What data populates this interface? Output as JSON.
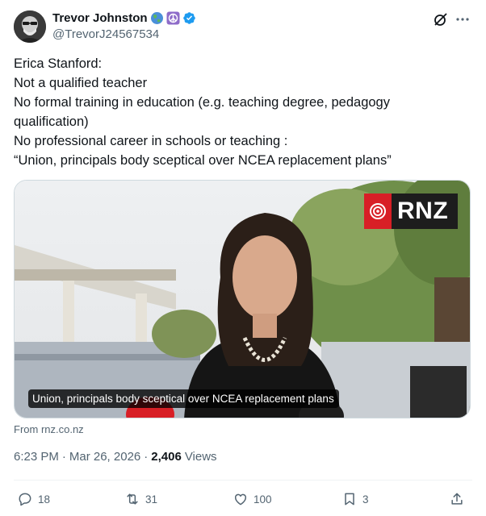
{
  "author": {
    "name": "Trevor Johnston",
    "handle": "@TrevorJ24567534",
    "badges": [
      "globe-emoji",
      "peace-symbol-emoji",
      "verified-badge"
    ]
  },
  "tweet": {
    "lines": [
      "Erica Stanford:",
      "Not a qualified teacher",
      "No formal training in education (e.g. teaching degree, pedagogy",
      "qualification)",
      "No professional career in schools or teaching :",
      "“Union, principals body sceptical over NCEA replacement plans”"
    ]
  },
  "card": {
    "caption": "Union, principals body sceptical over NCEA replacement plans",
    "logo_text": "RNZ",
    "source": "From rnz.co.nz"
  },
  "meta": {
    "time": "6:23 PM",
    "separator": "·",
    "date": "Mar 26, 2026",
    "views_count": "2,406",
    "views_label": "Views"
  },
  "actions": {
    "replies": "18",
    "reposts": "31",
    "likes": "100",
    "bookmarks": "3"
  },
  "colors": {
    "text": "#0f1419",
    "secondary": "#536471",
    "verified": "#1d9bf0",
    "rnz_red": "#d81f26"
  }
}
